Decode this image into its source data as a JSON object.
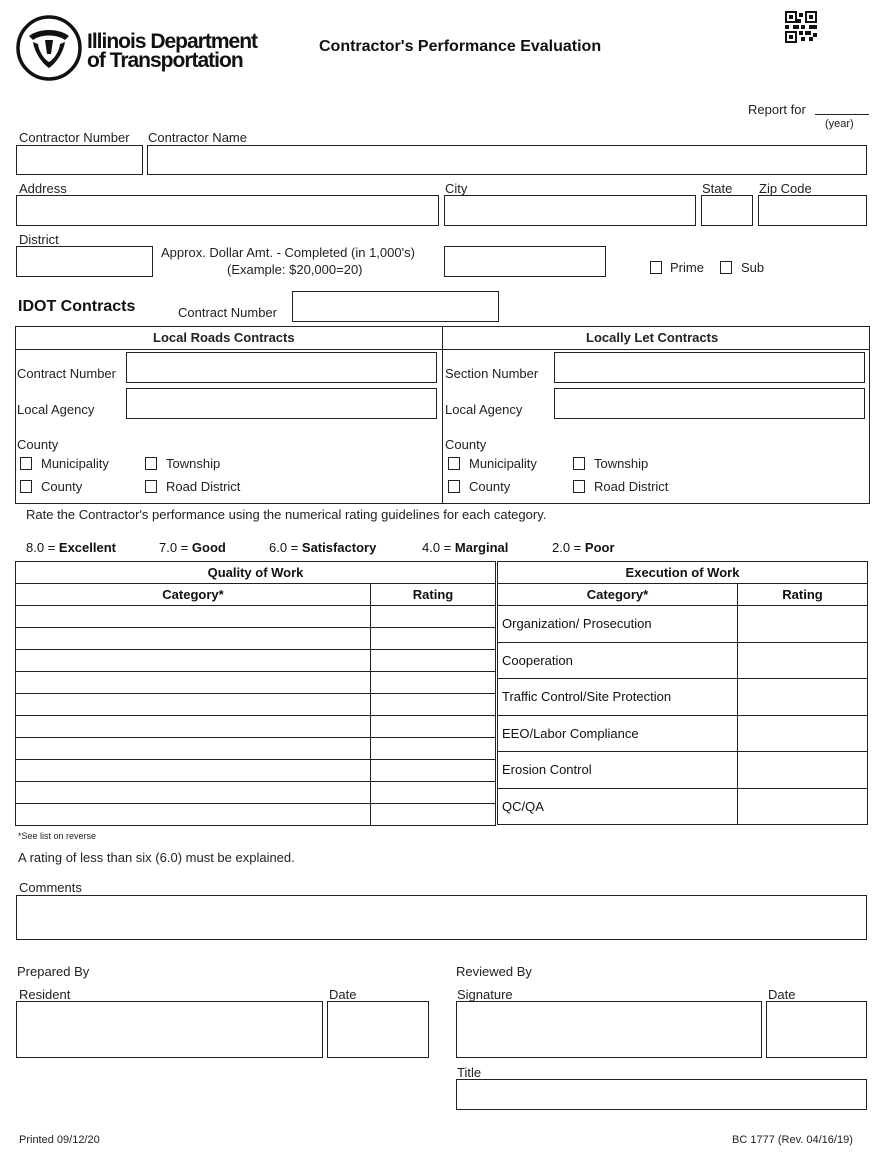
{
  "header": {
    "agency_line1": "Illinois Department",
    "agency_line2": "of Transportation",
    "form_title": "Contractor's Performance Evaluation",
    "report_for_label": "Report for",
    "year_label": "(year)",
    "logo_icon": "idot-logo-icon",
    "qr_icon": "qr-code-icon"
  },
  "contractor": {
    "contractor_number_label": "Contractor Number",
    "contractor_name_label": "Contractor Name",
    "address_label": "Address",
    "city_label": "City",
    "state_label": "State",
    "zip_label": "Zip Code",
    "district_label": "District",
    "dollar_amt_label_line1": "Approx. Dollar Amt. - Completed (in 1,000's)",
    "dollar_amt_label_line2": "(Example: $20,000=20)",
    "prime_label": "Prime",
    "sub_label": "Sub",
    "values": {
      "contractor_number": "",
      "contractor_name": "",
      "address": "",
      "city": "",
      "state": "",
      "zip": "",
      "district": "",
      "dollar_amt": "",
      "prime": false,
      "sub": false
    }
  },
  "idot": {
    "heading": "IDOT Contracts",
    "contract_number_label": "Contract Number",
    "contract_number": ""
  },
  "local_roads": {
    "heading": "Local Roads Contracts",
    "contract_number_label": "Contract Number",
    "local_agency_label": "Local Agency",
    "county_label": "County",
    "options": [
      "Municipality",
      "Township",
      "County",
      "Road District"
    ]
  },
  "locally_let": {
    "heading": "Locally Let Contracts",
    "section_number_label": "Section Number",
    "local_agency_label": "Local Agency",
    "county_label": "County",
    "options": [
      "Municipality",
      "Township",
      "County",
      "Road District"
    ]
  },
  "rating_guide": {
    "instructions": "Rate the Contractor's performance using the numerical rating guidelines for each category.",
    "scale": [
      {
        "value": "8.0 =",
        "label": "Excellent"
      },
      {
        "value": "7.0 =",
        "label": "Good"
      },
      {
        "value": "6.0 =",
        "label": "Satisfactory"
      },
      {
        "value": "4.0 =",
        "label": "Marginal"
      },
      {
        "value": "2.0 =",
        "label": "Poor"
      }
    ]
  },
  "quality_of_work": {
    "heading": "Quality of Work",
    "col_category": "Category*",
    "col_rating": "Rating",
    "rows": [
      {
        "category": "",
        "rating": ""
      },
      {
        "category": "",
        "rating": ""
      },
      {
        "category": "",
        "rating": ""
      },
      {
        "category": "",
        "rating": ""
      },
      {
        "category": "",
        "rating": ""
      },
      {
        "category": "",
        "rating": ""
      },
      {
        "category": "",
        "rating": ""
      },
      {
        "category": "",
        "rating": ""
      },
      {
        "category": "",
        "rating": ""
      },
      {
        "category": "",
        "rating": ""
      }
    ]
  },
  "execution_of_work": {
    "heading": "Execution of Work",
    "col_category": "Category*",
    "col_rating": "Rating",
    "rows": [
      {
        "category": "Organization/ Prosecution",
        "rating": ""
      },
      {
        "category": "Cooperation",
        "rating": ""
      },
      {
        "category": "Traffic Control/Site Protection",
        "rating": ""
      },
      {
        "category": "EEO/Labor Compliance",
        "rating": ""
      },
      {
        "category": "Erosion Control",
        "rating": ""
      },
      {
        "category": "QC/QA",
        "rating": ""
      }
    ]
  },
  "notes": {
    "see_reverse": "*See list on reverse",
    "explain": "A rating of less than six (6.0) must be explained."
  },
  "comments": {
    "label": "Comments",
    "value": ""
  },
  "prepared_by": {
    "heading": "Prepared By",
    "resident_label": "Resident",
    "date_label": "Date"
  },
  "reviewed_by": {
    "heading": "Reviewed By",
    "signature_label": "Signature",
    "date_label": "Date",
    "title_label": "Title"
  },
  "footer": {
    "printed": "Printed 09/12/20",
    "form_id": "BC 1777 (Rev. 04/16/19)"
  }
}
